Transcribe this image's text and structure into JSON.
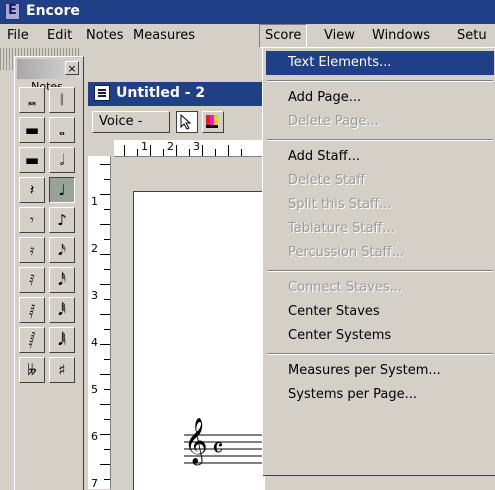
{
  "app": {
    "title": "Encore"
  },
  "menubar": [
    {
      "label": "File"
    },
    {
      "label": "Edit"
    },
    {
      "label": "Notes"
    },
    {
      "label": "Measures"
    },
    {
      "label": "Score",
      "active": true
    },
    {
      "label": "View"
    },
    {
      "label": "Windows"
    },
    {
      "label": "Setu"
    }
  ],
  "palette": {
    "close_label": "×",
    "label": "Notes",
    "buttons": [
      {
        "name": "breve-note-button",
        "glyph": "𝅜"
      },
      {
        "name": "double-whole-note-button",
        "glyph": "𝄁"
      },
      {
        "name": "whole-rest-button",
        "glyph": "▬"
      },
      {
        "name": "whole-note-button",
        "glyph": "𝅝"
      },
      {
        "name": "half-rest-button",
        "glyph": "▬"
      },
      {
        "name": "half-note-button",
        "glyph": "𝅗𝅥"
      },
      {
        "name": "quarter-rest-button",
        "glyph": "𝄽"
      },
      {
        "name": "quarter-note-button",
        "glyph": "♩",
        "selected": true
      },
      {
        "name": "eighth-rest-button",
        "glyph": "𝄾"
      },
      {
        "name": "eighth-note-button",
        "glyph": "♪"
      },
      {
        "name": "sixteenth-rest-button",
        "glyph": "𝄿"
      },
      {
        "name": "sixteenth-note-button",
        "glyph": "𝅘𝅥𝅯"
      },
      {
        "name": "thirty-second-rest-button",
        "glyph": "𝅀"
      },
      {
        "name": "thirty-second-note-button",
        "glyph": "𝅘𝅥𝅰"
      },
      {
        "name": "sixty-fourth-rest-button",
        "glyph": "𝅁"
      },
      {
        "name": "sixty-fourth-note-button",
        "glyph": "𝅘𝅥𝅱"
      },
      {
        "name": "hundred-twenty-eighth-rest-button",
        "glyph": "𝅂"
      },
      {
        "name": "hundred-twenty-eighth-note-button",
        "glyph": "𝅘𝅥𝅲"
      },
      {
        "name": "double-flat-button",
        "glyph": "𝄫"
      },
      {
        "name": "sharp-button",
        "glyph": "♯"
      }
    ]
  },
  "document": {
    "title": "Untitled - 2",
    "voice_label": "Voice -",
    "hruler_numbers": [
      "1",
      "2",
      "3"
    ],
    "vruler_numbers": [
      "1",
      "2",
      "3",
      "4",
      "5",
      "6",
      "7"
    ],
    "clef_glyph": "𝄞",
    "time_sig_glyph": "𝄴"
  },
  "score_menu": [
    {
      "name": "text-elements",
      "label": "Text Elements...",
      "highlight": true
    },
    {
      "sep": true
    },
    {
      "name": "add-page",
      "label": "Add Page..."
    },
    {
      "name": "delete-page",
      "label": "Delete Page...",
      "disabled": true
    },
    {
      "sep": true
    },
    {
      "name": "add-staff",
      "label": "Add Staff..."
    },
    {
      "name": "delete-staff",
      "label": "Delete Staff",
      "disabled": true
    },
    {
      "name": "split-this-staff",
      "label": "Split this Staff...",
      "disabled": true
    },
    {
      "name": "tablature-staff",
      "label": "Tablature Staff...",
      "disabled": true
    },
    {
      "name": "percussion-staff",
      "label": "Percussion Staff...",
      "disabled": true
    },
    {
      "sep": true
    },
    {
      "name": "connect-staves",
      "label": "Connect Staves...",
      "disabled": true
    },
    {
      "name": "center-staves",
      "label": "Center Staves"
    },
    {
      "name": "center-systems",
      "label": "Center Systems"
    },
    {
      "sep": true
    },
    {
      "name": "measures-per-system",
      "label": "Measures per System..."
    },
    {
      "name": "systems-per-page",
      "label": "Systems per Page..."
    }
  ]
}
